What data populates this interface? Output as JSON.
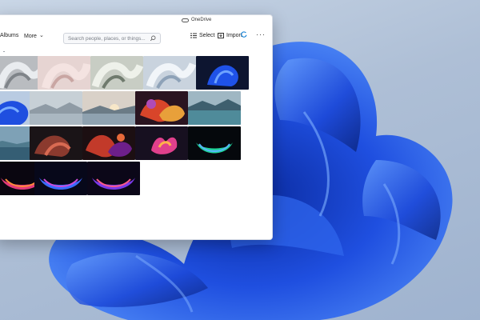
{
  "window": {
    "account_label": "OneDrive"
  },
  "toolbar": {
    "albums_label": "Albums",
    "more_label": "More",
    "search_placeholder": "Search people, places, or things...",
    "select_label": "Select",
    "import_label": "Import"
  },
  "icons": {
    "onedrive": "cloud-icon",
    "chevron": "chevron-down-icon",
    "search": "search-icon",
    "select": "select-icon",
    "import": "import-icon",
    "sync": "sync-icon",
    "more": "more-options-icon"
  },
  "colors": {
    "accent": "#0078d4",
    "wallpaper_bloom": "#1f4fe0",
    "wallpaper_background": "#aebfd6"
  },
  "gallery": {
    "rows": [
      [
        {
          "theme": "silver-ribbon"
        },
        {
          "theme": "pink-ribbon"
        },
        {
          "theme": "sage-ribbon"
        },
        {
          "theme": "pale-blue-ribbon"
        },
        {
          "theme": "blue-bloom-dark"
        }
      ],
      [
        {
          "theme": "blue-bloom"
        },
        {
          "theme": "misty-lake"
        },
        {
          "theme": "sunrise-lake"
        },
        {
          "theme": "colorful-glow"
        },
        {
          "theme": "teal-lake"
        }
      ],
      [
        {
          "theme": "dawn-lake"
        },
        {
          "theme": "dark-flow"
        },
        {
          "theme": "red-shapes"
        },
        {
          "theme": "orchid-bloom"
        },
        {
          "theme": "green-glow"
        }
      ],
      [
        {
          "theme": "magenta-glow"
        },
        {
          "theme": "violet-glow"
        },
        {
          "theme": "purple-glow"
        }
      ]
    ]
  }
}
